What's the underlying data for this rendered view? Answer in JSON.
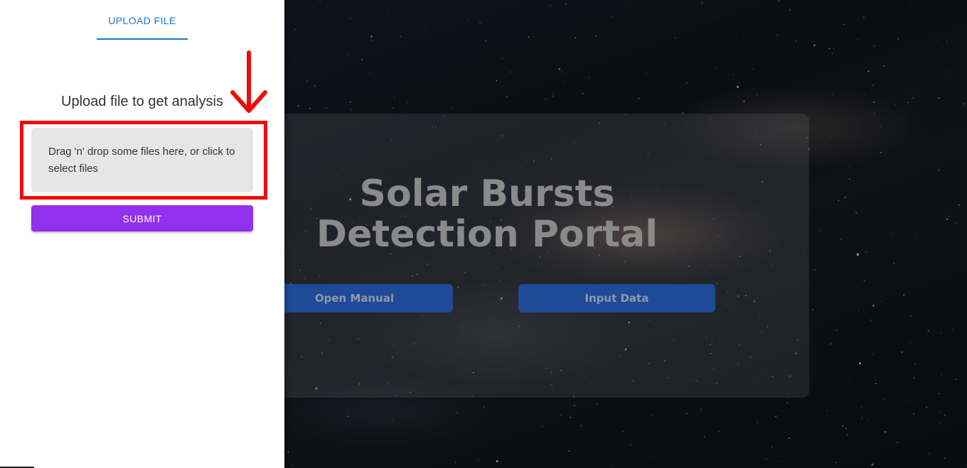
{
  "drawer": {
    "tab_label": "UPLOAD FILE",
    "heading": "Upload file to get analysis",
    "dropzone_text": "Drag 'n' drop some files here, or click to select files",
    "submit_label": "SUBMIT"
  },
  "hero": {
    "title_line1": "Solar Bursts",
    "title_line2": "Detection Portal",
    "open_manual_label": "Open Manual",
    "input_data_label": "Input Data"
  },
  "colors": {
    "tab_accent": "#1976d2",
    "submit": "#9130ed",
    "highlight": "#f00b0b",
    "hero_button": "#1f4a96"
  }
}
